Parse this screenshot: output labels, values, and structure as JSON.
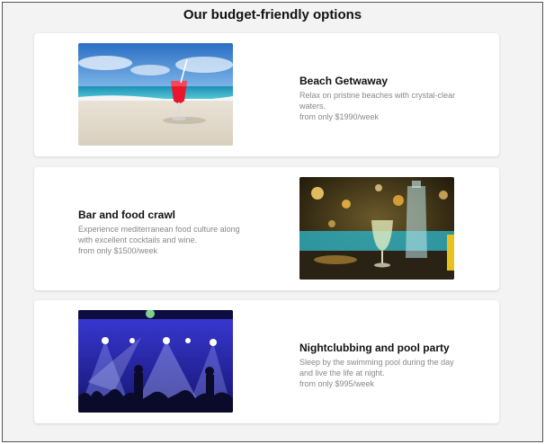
{
  "page": {
    "title": "Our budget-friendly options"
  },
  "options": [
    {
      "title": "Beach Getwaway",
      "description": "Relax on pristine beaches with crystal-clear waters.",
      "price": "from only $1990/week"
    },
    {
      "title": "Bar and food crawl",
      "description": "Experience mediterranean food culture along with excellent cocktails and wine.",
      "price": "from only $1500/week"
    },
    {
      "title": "Nightclubbing and pool party",
      "description": "Sleep by the swimming pool during the day and live the life at night.",
      "price": "from only $995/week"
    }
  ],
  "colors": {
    "page_bg": "#f3f3f4",
    "card_bg": "#ffffff",
    "muted_text": "#888888"
  }
}
